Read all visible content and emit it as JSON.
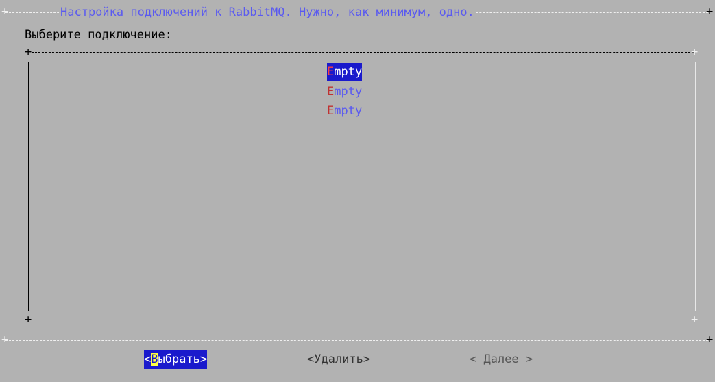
{
  "dialog": {
    "title": "Настройка подключений к RabbitMQ. Нужно, как минимум, одно.",
    "prompt": "Выберите подключение:"
  },
  "list": {
    "items": [
      {
        "hotkey": "E",
        "rest": "mpty",
        "selected": true
      },
      {
        "hotkey": "E",
        "rest": "mpty",
        "selected": false
      },
      {
        "hotkey": "E",
        "rest": "mpty",
        "selected": false
      }
    ]
  },
  "buttons": {
    "select": {
      "open": "<",
      "hotkey": "В",
      "rest": "ыбрать>"
    },
    "delete": {
      "label": "<Удалить>"
    },
    "next": {
      "label": "< Далее >"
    }
  },
  "colors": {
    "background": "#b2b2b2",
    "title": "#5a5af0",
    "selection": "#1a1acc",
    "hotkey": "#c03030",
    "hotkey_highlight": "#ffff44"
  }
}
